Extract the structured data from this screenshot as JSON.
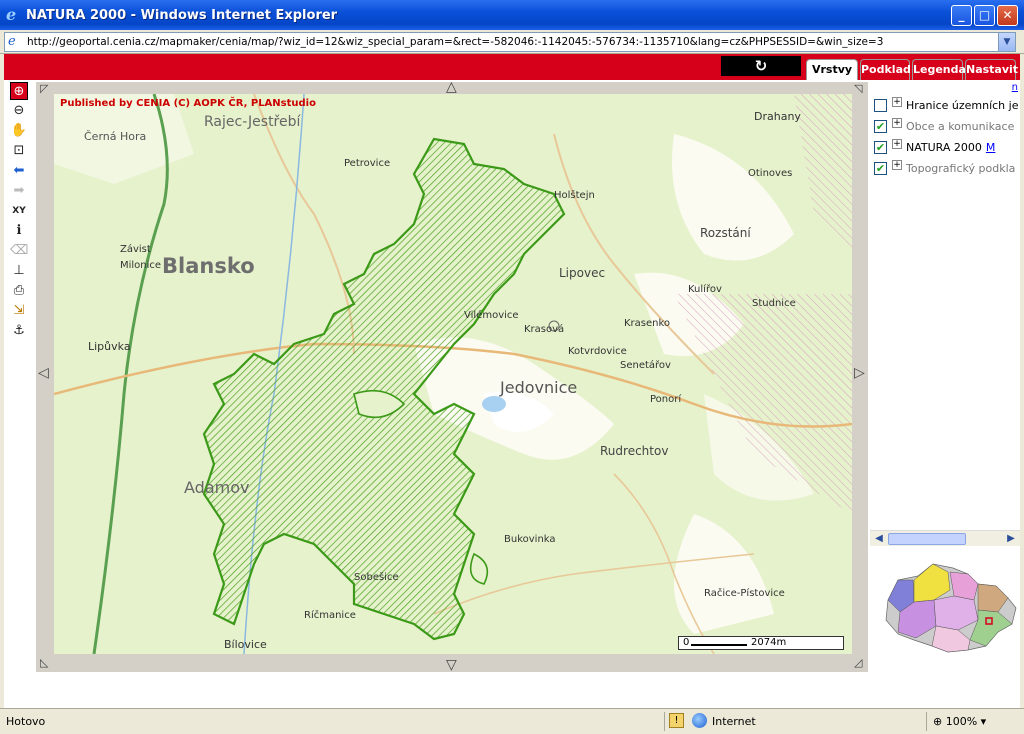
{
  "window": {
    "title": "NATURA 2000 - Windows Internet Explorer",
    "minimize_glyph": "_",
    "maximize_glyph": "□",
    "close_glyph": "✕"
  },
  "address": {
    "url": "http://geoportal.cenia.cz/mapmaker/cenia/map/?wiz_id=12&wiz_special_param=&rect=-582046:-1142045:-576734:-1135710&lang=cz&PHPSESSID=&win_size=3"
  },
  "tabs": [
    "Vrstvy",
    "Podklad",
    "Legenda",
    "Nastavit"
  ],
  "refresh_icon": "↻",
  "toolbar": [
    {
      "icon": "zoom-in-icon",
      "glyph": "⊕"
    },
    {
      "icon": "zoom-out-icon",
      "glyph": "⊖"
    },
    {
      "icon": "pan-hand-icon",
      "glyph": "✋"
    },
    {
      "icon": "full-extent-icon",
      "glyph": "⊡"
    },
    {
      "icon": "back-arrow-icon",
      "glyph": "⬅"
    },
    {
      "icon": "forward-arrow-icon",
      "glyph": "➡"
    },
    {
      "icon": "xy-coordinates-icon",
      "glyph": "XY"
    },
    {
      "icon": "info-icon",
      "glyph": "ℹ"
    },
    {
      "icon": "eraser-icon",
      "glyph": "⌫"
    },
    {
      "icon": "measure-icon",
      "glyph": "⊥"
    },
    {
      "icon": "print-icon",
      "glyph": "⎙"
    },
    {
      "icon": "export-icon",
      "glyph": "⇲"
    },
    {
      "icon": "anchor-icon",
      "glyph": "⚓"
    }
  ],
  "map": {
    "copyright": "Published by CENIA  (C) AOPK ČR, PLANstudio",
    "scale_zero": "0",
    "scale_distance": "2074m",
    "labels": {
      "blansko": "Blansko",
      "jedovnice": "Jedovnice",
      "adamov": "Adamov",
      "rudrechtov": "Rudrechtov",
      "rozstani": "Rozstání",
      "lipovec": "Lipovec",
      "krasova": "Krasová",
      "petrovice": "Petrovice",
      "rajec": "Rajec-Jestřebí",
      "cerna_hora": "Černá Hora",
      "bukovinka": "Bukovinka",
      "sobesice": "Sobešice",
      "ponori": "Ponorí",
      "senetarov": "Senetářov",
      "studnice": "Studnice",
      "drahany": "Drahany",
      "otinoves": "Otinoves",
      "krasenko": "Krasenko",
      "kulirov": "Kulířov",
      "vilemovice": "Vilémovice",
      "kotvrdovice": "Kotvrdovice",
      "lipuvka": "Lipůvka",
      "racice": "Račice-Pístovice",
      "bilovice": "Bílovice",
      "ricmanice": "Ríčmanice",
      "holstejn": "Holštejn",
      "zavist": "Závist",
      "milonice": "Milonice"
    }
  },
  "layers": {
    "top_link": "n",
    "items": [
      {
        "label": "Hranice územních je",
        "checked": false,
        "grey": false
      },
      {
        "label": "Obce a komunikace",
        "checked": true,
        "grey": true
      },
      {
        "label": "NATURA 2000",
        "checked": true,
        "grey": false,
        "link": "M"
      },
      {
        "label": "Topografický podkla",
        "checked": true,
        "grey": true
      }
    ]
  },
  "status": {
    "text": "Hotovo",
    "zone": "Internet",
    "zoom": "100%"
  },
  "colors": {
    "brand_red": "#d7001a",
    "natura_green": "#4aa020",
    "xp_blue": "#0a50d8"
  }
}
